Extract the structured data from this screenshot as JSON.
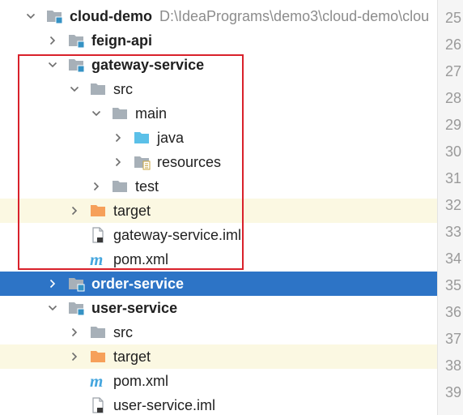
{
  "tree": [
    {
      "id": "cloud-demo",
      "label": "cloud-demo",
      "path": "D:\\IdeaPrograms\\demo3\\cloud-demo\\clou",
      "arrow": "down",
      "icon": "module",
      "bold": true,
      "depth": 0,
      "highlight": false,
      "selected": false
    },
    {
      "id": "feign-api",
      "label": "feign-api",
      "arrow": "right",
      "icon": "module",
      "bold": true,
      "depth": 1,
      "highlight": false,
      "selected": false
    },
    {
      "id": "gateway-service",
      "label": "gateway-service",
      "arrow": "down",
      "icon": "module",
      "bold": true,
      "depth": 1,
      "highlight": false,
      "selected": false
    },
    {
      "id": "gateway-src",
      "label": "src",
      "arrow": "down",
      "icon": "folder-gray",
      "bold": false,
      "depth": 2,
      "highlight": false,
      "selected": false
    },
    {
      "id": "gateway-main",
      "label": "main",
      "arrow": "down",
      "icon": "folder-gray",
      "bold": false,
      "depth": 3,
      "highlight": false,
      "selected": false
    },
    {
      "id": "gateway-java",
      "label": "java",
      "arrow": "right",
      "icon": "folder-blue",
      "bold": false,
      "depth": 4,
      "highlight": false,
      "selected": false
    },
    {
      "id": "gateway-resources",
      "label": "resources",
      "arrow": "right",
      "icon": "folder-resources",
      "bold": false,
      "depth": 4,
      "highlight": false,
      "selected": false
    },
    {
      "id": "gateway-test",
      "label": "test",
      "arrow": "right",
      "icon": "folder-gray",
      "bold": false,
      "depth": 3,
      "highlight": false,
      "selected": false
    },
    {
      "id": "gateway-target",
      "label": "target",
      "arrow": "right",
      "icon": "folder-orange",
      "bold": false,
      "depth": 2,
      "highlight": true,
      "selected": false
    },
    {
      "id": "gateway-iml",
      "label": "gateway-service.iml",
      "arrow": "none",
      "icon": "file-iml",
      "bold": false,
      "depth": 2,
      "highlight": false,
      "selected": false
    },
    {
      "id": "gateway-pom",
      "label": "pom.xml",
      "arrow": "none",
      "icon": "maven-m",
      "bold": false,
      "depth": 2,
      "highlight": false,
      "selected": false
    },
    {
      "id": "order-service",
      "label": "order-service",
      "arrow": "right",
      "icon": "module",
      "bold": true,
      "depth": 1,
      "highlight": false,
      "selected": true
    },
    {
      "id": "user-service",
      "label": "user-service",
      "arrow": "down",
      "icon": "module",
      "bold": true,
      "depth": 1,
      "highlight": false,
      "selected": false
    },
    {
      "id": "user-src",
      "label": "src",
      "arrow": "right",
      "icon": "folder-gray",
      "bold": false,
      "depth": 2,
      "highlight": false,
      "selected": false
    },
    {
      "id": "user-target",
      "label": "target",
      "arrow": "right",
      "icon": "folder-orange",
      "bold": false,
      "depth": 2,
      "highlight": true,
      "selected": false
    },
    {
      "id": "user-pom",
      "label": "pom.xml",
      "arrow": "none",
      "icon": "maven-m",
      "bold": false,
      "depth": 2,
      "highlight": false,
      "selected": false
    },
    {
      "id": "user-iml",
      "label": "user-service.iml",
      "arrow": "none",
      "icon": "file-iml",
      "bold": false,
      "depth": 2,
      "highlight": false,
      "selected": false
    }
  ],
  "line_numbers": [
    "25",
    "26",
    "27",
    "28",
    "29",
    "30",
    "31",
    "32",
    "33",
    "34",
    "35",
    "36",
    "37",
    "38",
    "39"
  ],
  "annotation": {
    "color": "#d9212b",
    "encloses": "gateway-service"
  },
  "colors": {
    "selection": "#2d74c6",
    "highlight_row": "#fbf8e2",
    "folder_gray": "#a7b0b8",
    "folder_blue": "#5bc0e8",
    "folder_orange": "#f6a05a",
    "module_badge": "#3592c4",
    "maven": "#45a6de"
  }
}
